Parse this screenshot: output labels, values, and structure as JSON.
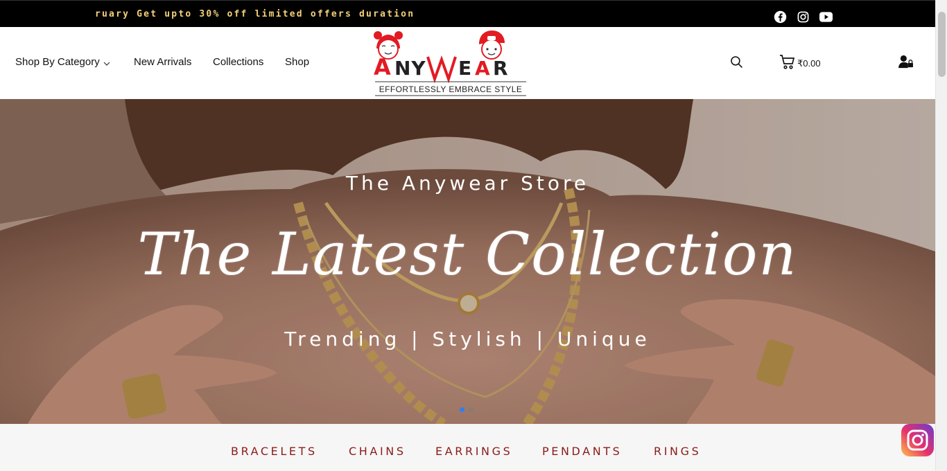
{
  "announcement": {
    "text": "ruary  Get  upto  30%  off  limited  offers  duration"
  },
  "social_icons": [
    "facebook-icon",
    "instagram-icon",
    "youtube-icon"
  ],
  "nav": {
    "items": [
      {
        "label": "Shop By Category",
        "has_dropdown": true
      },
      {
        "label": "New Arrivals"
      },
      {
        "label": "Collections"
      },
      {
        "label": "Shop"
      }
    ]
  },
  "logo": {
    "brand": "ANYWEAR",
    "tagline": "EFFORTLESSLY EMBRACE STYLE"
  },
  "header_icons": {
    "search": "search-icon",
    "cart": "cart-icon",
    "cart_amount": "₹0.00",
    "account": "user-lock-icon"
  },
  "hero": {
    "subtitle": "The Anywear Store",
    "title": "The Latest Collection",
    "tagline": "Trending | Stylish | Unique",
    "slides": 2,
    "active_slide": 1
  },
  "categories": [
    "BRACELETS",
    "CHAINS",
    "EARRINGS",
    "PENDANTS",
    "RINGS"
  ],
  "colors": {
    "topbar_bg": "#000000",
    "announcement_text": "#f6d27a",
    "category_text": "#8b1a1a",
    "brand_red": "#e21b23",
    "active_dot": "#2f7ff0"
  }
}
